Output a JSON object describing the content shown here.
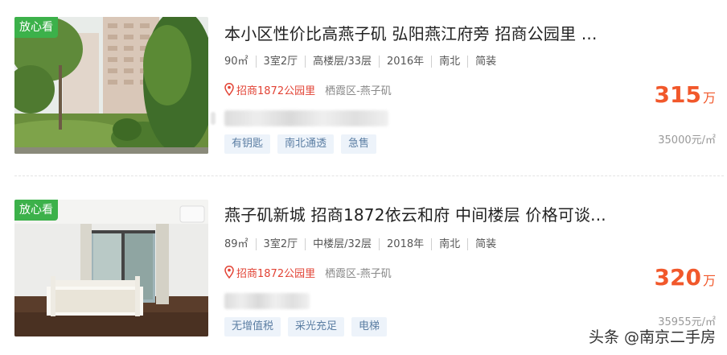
{
  "listings": [
    {
      "badge": "放心看",
      "title": "本小区性价比高燕子矶 弘阳燕江府旁 招商公园里 ...",
      "specs": [
        "90㎡",
        "3室2厅",
        "高楼层/33层",
        "2016年",
        "南北",
        "简装"
      ],
      "community": "招商1872公园里",
      "district": "栖霞区-燕子矶",
      "tags": [
        "有钥匙",
        "南北通透",
        "急售"
      ],
      "price": "315",
      "price_unit": "万",
      "unit_price": "35000元/㎡"
    },
    {
      "badge": "放心看",
      "title": "燕子矶新城 招商1872依云和府 中间楼层 价格可谈...",
      "specs": [
        "89㎡",
        "3室2厅",
        "中楼层/32层",
        "2018年",
        "南北",
        "简装"
      ],
      "community": "招商1872公园里",
      "district": "栖霞区-燕子矶",
      "tags": [
        "无增值税",
        "采光充足",
        "电梯"
      ],
      "price": "320",
      "price_unit": "万",
      "unit_price": "35955元/㎡"
    }
  ],
  "watermark": "头条 @南京二手房",
  "colors": {
    "badge": "#3cb14a",
    "price": "#f1582b",
    "community": "#e24335",
    "tag_bg": "#edf3fa",
    "tag_text": "#5b7ea3"
  },
  "icons": [
    "map-pin-icon"
  ]
}
